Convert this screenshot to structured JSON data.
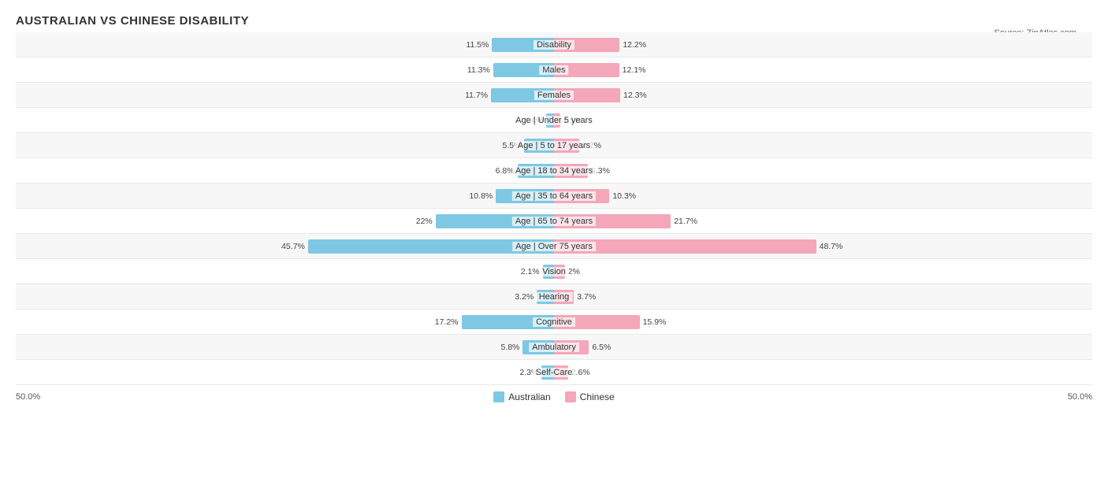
{
  "title": "AUSTRALIAN VS CHINESE DISABILITY",
  "source": "Source: ZipAtlas.com",
  "chart": {
    "max_percent": 50,
    "rows": [
      {
        "label": "Disability",
        "left_val": 11.5,
        "right_val": 12.2
      },
      {
        "label": "Males",
        "left_val": 11.3,
        "right_val": 12.1
      },
      {
        "label": "Females",
        "left_val": 11.7,
        "right_val": 12.3
      },
      {
        "label": "Age | Under 5 years",
        "left_val": 1.4,
        "right_val": 1.1
      },
      {
        "label": "Age | 5 to 17 years",
        "left_val": 5.5,
        "right_val": 4.7
      },
      {
        "label": "Age | 18 to 34 years",
        "left_val": 6.8,
        "right_val": 6.3
      },
      {
        "label": "Age | 35 to 64 years",
        "left_val": 10.8,
        "right_val": 10.3
      },
      {
        "label": "Age | 65 to 74 years",
        "left_val": 22.0,
        "right_val": 21.7
      },
      {
        "label": "Age | Over 75 years",
        "left_val": 45.7,
        "right_val": 48.7
      },
      {
        "label": "Vision",
        "left_val": 2.1,
        "right_val": 2.0
      },
      {
        "label": "Hearing",
        "left_val": 3.2,
        "right_val": 3.7
      },
      {
        "label": "Cognitive",
        "left_val": 17.2,
        "right_val": 15.9
      },
      {
        "label": "Ambulatory",
        "left_val": 5.8,
        "right_val": 6.5
      },
      {
        "label": "Self-Care",
        "left_val": 2.3,
        "right_val": 2.6
      }
    ]
  },
  "legend": {
    "australian_label": "Australian",
    "chinese_label": "Chinese",
    "australian_color": "#7ec8e3",
    "chinese_color": "#f4a7b9"
  },
  "footer": {
    "left_scale": "50.0%",
    "right_scale": "50.0%"
  }
}
